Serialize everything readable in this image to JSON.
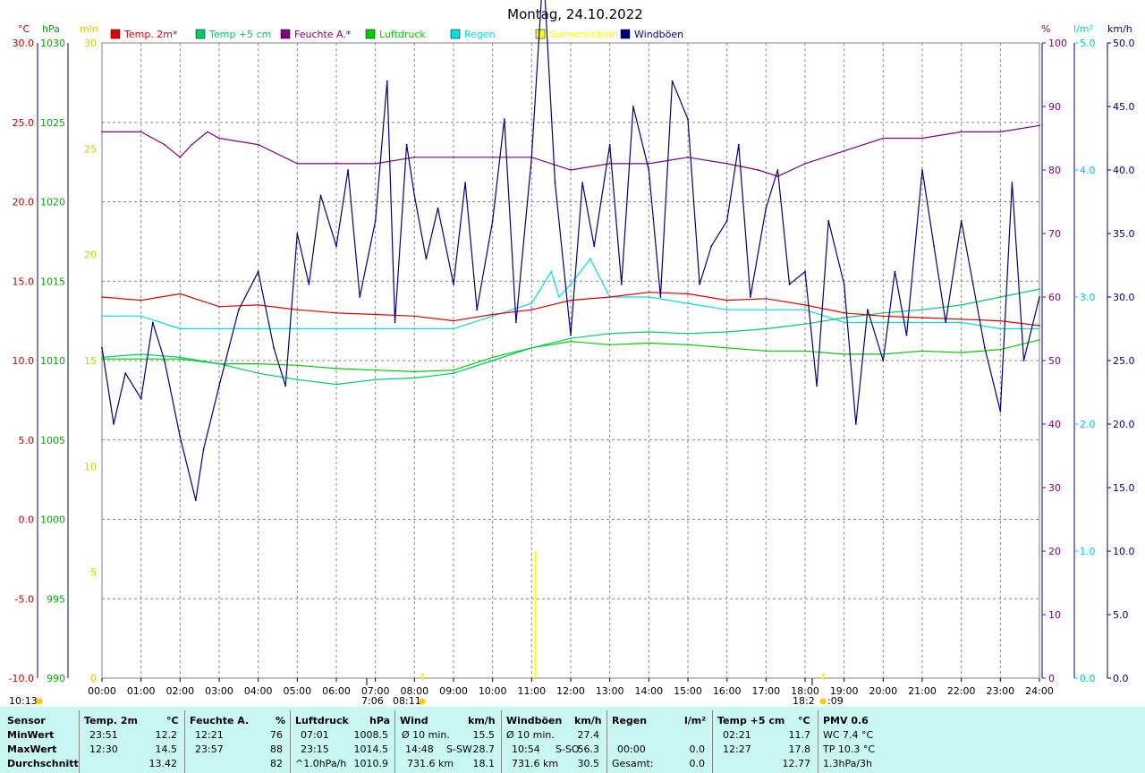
{
  "title": "Montag, 24.10.2022",
  "colors": {
    "temp2m": "#e00000",
    "temp5cm": "#00cc66",
    "humidity": "#800080",
    "pressure": "#00cc00",
    "rain": "#00e0e0",
    "sun": "#ffff00",
    "gust": "#000080",
    "grid": "#888888"
  },
  "axes": {
    "temp": {
      "unit": "°C",
      "ticks": [
        "30.0",
        "25.0",
        "20.0",
        "15.0",
        "10.0",
        "5.0",
        "0.0",
        "-5.0",
        "-10.0"
      ]
    },
    "pressure": {
      "unit": "hPa",
      "ticks": [
        "1030",
        "1025",
        "1020",
        "1015",
        "1010",
        "1005",
        "1000",
        "995",
        "990"
      ]
    },
    "sunmin": {
      "unit": "min",
      "ticks": [
        "30",
        "25",
        "20",
        "15",
        "10",
        "5",
        "0"
      ]
    },
    "humidity": {
      "unit": "%",
      "ticks": [
        "100",
        "90",
        "80",
        "70",
        "60",
        "50",
        "40",
        "30",
        "20",
        "10",
        "0"
      ]
    },
    "rain": {
      "unit": "l/m²",
      "ticks": [
        "5.0",
        "4.0",
        "3.0",
        "2.0",
        "1.0",
        "0.0"
      ]
    },
    "wind": {
      "unit": "km/h",
      "ticks": [
        "50.0",
        "45.0",
        "40.0",
        "35.0",
        "30.0",
        "25.0",
        "20.0",
        "15.0",
        "10.0",
        "5.0",
        "0.0"
      ]
    },
    "x": {
      "ticks": [
        "00:00",
        "01:00",
        "02:00",
        "03:00",
        "04:00",
        "05:00",
        "06:00",
        "07:00",
        "08:00",
        "09:00",
        "10:00",
        "11:00",
        "12:00",
        "13:00",
        "14:00",
        "15:00",
        "16:00",
        "17:00",
        "18:00",
        "19:00",
        "20:00",
        "21:00",
        "22:00",
        "23:00",
        "24:00"
      ]
    }
  },
  "legend": [
    {
      "label": "Temp. 2m*",
      "color": "#e00000"
    },
    {
      "label": "Temp +5 cm",
      "color": "#00cc66"
    },
    {
      "label": "Feuchte A.*",
      "color": "#800080"
    },
    {
      "label": "Luftdruck",
      "color": "#00cc00"
    },
    {
      "label": "Regen",
      "color": "#00e0e0"
    },
    {
      "label": "Sonnenschein",
      "color": "#ffff00"
    },
    {
      "label": "Windböen",
      "color": "#000080"
    }
  ],
  "sun_markers": {
    "sunrise": "7:06",
    "sunrise_event": "08:11",
    "sunset": "18:2",
    "sunset_event": ":09",
    "daylength": "10:13"
  },
  "chart_data": {
    "type": "line",
    "x_unit": "hour",
    "series": [
      {
        "name": "Temp. 2m*",
        "axis": "temp",
        "x": [
          0,
          1,
          2,
          3,
          4,
          5,
          6,
          7,
          8,
          9,
          10,
          11,
          12,
          13,
          14,
          15,
          16,
          17,
          18,
          19,
          20,
          21,
          22,
          23,
          24
        ],
        "values": [
          14.0,
          13.8,
          14.2,
          13.4,
          13.5,
          13.2,
          13.0,
          12.9,
          12.8,
          12.5,
          12.9,
          13.2,
          13.8,
          14.0,
          14.3,
          14.2,
          13.8,
          13.9,
          13.5,
          13.0,
          12.8,
          12.7,
          12.6,
          12.5,
          12.2
        ]
      },
      {
        "name": "Temp +5 cm",
        "axis": "temp",
        "x": [
          0,
          1,
          2,
          3,
          4,
          5,
          6,
          7,
          8,
          9,
          10,
          11,
          12,
          13,
          14,
          15,
          16,
          17,
          18,
          19,
          20,
          21,
          22,
          23,
          24
        ],
        "values": [
          10.2,
          10.4,
          10.2,
          9.8,
          9.2,
          8.8,
          8.5,
          8.8,
          8.9,
          9.2,
          10.0,
          10.8,
          11.4,
          11.7,
          11.8,
          11.7,
          11.8,
          12.0,
          12.3,
          12.7,
          13.0,
          13.2,
          13.5,
          14.0,
          14.5
        ]
      },
      {
        "name": "Feuchte A.*",
        "axis": "humidity",
        "x": [
          0,
          1,
          1.6,
          2,
          2.3,
          2.7,
          3,
          4,
          5,
          6,
          7,
          8,
          9,
          10,
          11,
          12,
          13,
          14,
          15,
          16,
          16.8,
          17.3,
          18,
          19,
          20,
          21,
          22,
          23,
          24
        ],
        "values": [
          86,
          86,
          84,
          82,
          84,
          86,
          85,
          84,
          81,
          81,
          81,
          82,
          82,
          82,
          82,
          80,
          81,
          81,
          82,
          81,
          80,
          79,
          81,
          83,
          85,
          85,
          86,
          86,
          87
        ]
      },
      {
        "name": "Luftdruck",
        "axis": "pressure",
        "x": [
          0,
          1,
          2,
          3,
          4,
          5,
          6,
          7,
          8,
          9,
          10,
          11,
          12,
          13,
          14,
          15,
          16,
          17,
          18,
          19,
          20,
          21,
          22,
          23,
          24
        ],
        "values": [
          1010.1,
          1010.1,
          1010.1,
          1009.8,
          1009.8,
          1009.7,
          1009.5,
          1009.4,
          1009.3,
          1009.4,
          1010.2,
          1010.8,
          1011.2,
          1011.0,
          1011.1,
          1011.0,
          1010.8,
          1010.6,
          1010.6,
          1010.4,
          1010.4,
          1010.6,
          1010.5,
          1010.7,
          1011.3
        ]
      },
      {
        "name": "Regen",
        "axis": "rain",
        "x": [
          0,
          1,
          2,
          3,
          4,
          5,
          6,
          7,
          8,
          9,
          10,
          11,
          11.2,
          11.5,
          11.7,
          12,
          12.5,
          13,
          14,
          15,
          16,
          17,
          18,
          19,
          20,
          21,
          22,
          23,
          24
        ],
        "values": [
          2.85,
          2.85,
          2.75,
          2.75,
          2.75,
          2.75,
          2.75,
          2.75,
          2.75,
          2.75,
          2.85,
          2.95,
          3.05,
          3.2,
          3.0,
          3.1,
          3.3,
          3.0,
          3.0,
          2.95,
          2.9,
          2.9,
          2.9,
          2.8,
          2.8,
          2.8,
          2.8,
          2.75,
          2.75
        ]
      },
      {
        "name": "Windböen",
        "axis": "wind",
        "x": [
          0,
          0.3,
          0.6,
          1,
          1.3,
          1.6,
          2,
          2.4,
          2.6,
          3,
          3.5,
          4,
          4.4,
          4.7,
          5,
          5.3,
          5.6,
          6,
          6.3,
          6.6,
          7,
          7.3,
          7.5,
          7.8,
          8,
          8.3,
          8.6,
          9,
          9.3,
          9.6,
          10,
          10.3,
          10.6,
          11,
          11.3,
          11.6,
          12,
          12.3,
          12.6,
          13,
          13.3,
          13.6,
          14,
          14.3,
          14.6,
          15,
          15.3,
          15.6,
          16,
          16.3,
          16.6,
          17,
          17.3,
          17.6,
          18,
          18.3,
          18.6,
          19,
          19.3,
          19.6,
          20,
          20.3,
          20.6,
          21,
          21.3,
          21.6,
          22,
          22.3,
          22.6,
          23,
          23.3,
          23.6,
          24
        ],
        "values": [
          26,
          20,
          24,
          22,
          28,
          25,
          19,
          14,
          18,
          23,
          29,
          32,
          26,
          23,
          35,
          31,
          38,
          34,
          40,
          30,
          36,
          47,
          28,
          42,
          38,
          33,
          37,
          31,
          39,
          29,
          36,
          44,
          28,
          41,
          56,
          39,
          27,
          39,
          34,
          42,
          31,
          45,
          40,
          30,
          47,
          44,
          31,
          34,
          36,
          42,
          30,
          37,
          40,
          31,
          32,
          23,
          36,
          31,
          20,
          29,
          25,
          32,
          27,
          40,
          34,
          28,
          36,
          31,
          26,
          21,
          39,
          25,
          30
        ]
      }
    ],
    "sunshine_bars": [
      {
        "x": 11.1,
        "minutes": 6
      }
    ]
  },
  "stats": {
    "sensor": {
      "header": "Sensor",
      "rows": [
        "MinWert",
        "MaxWert",
        "Durchschnitt"
      ]
    },
    "temp2m": {
      "header": "Temp. 2m",
      "unit": "°C",
      "rows": [
        [
          "23:51",
          "12.2"
        ],
        [
          "12:30",
          "14.5"
        ],
        [
          "",
          "13.42"
        ]
      ]
    },
    "humidity": {
      "header": "Feuchte A.",
      "unit": "%",
      "rows": [
        [
          "12:21",
          "76"
        ],
        [
          "23:57",
          "88"
        ],
        [
          "",
          "82"
        ]
      ]
    },
    "pressure": {
      "header": "Luftdruck",
      "unit": "hPa",
      "rows": [
        [
          "07:01",
          "1008.5"
        ],
        [
          "23:15",
          "1014.5"
        ],
        [
          "^1.0hPa/h",
          "1010.9"
        ]
      ]
    },
    "wind": {
      "header": "Wind",
      "unit": "km/h",
      "rows": [
        [
          "Ø 10 min.",
          "",
          "15.5"
        ],
        [
          "14:48",
          "S-SW",
          "28.7"
        ],
        [
          "731.6 km",
          "",
          "18.1"
        ]
      ]
    },
    "gust": {
      "header": "Windböen",
      "unit": "km/h",
      "rows": [
        [
          "Ø 10 min.",
          "",
          "27.4"
        ],
        [
          "10:54",
          "S-SO",
          "56.3"
        ],
        [
          "731.6 km",
          "",
          "30.5"
        ]
      ]
    },
    "rain": {
      "header": "Regen",
      "unit": "l/m²",
      "rows": [
        [
          "",
          ""
        ],
        [
          "00:00",
          "0.0"
        ],
        [
          "Gesamt:",
          "0.0"
        ]
      ]
    },
    "temp5cm": {
      "header": "Temp +5 cm",
      "unit": "°C",
      "rows": [
        [
          "02:21",
          "11.7"
        ],
        [
          "12:27",
          "17.8"
        ],
        [
          "",
          "12.77"
        ]
      ]
    },
    "pmv": {
      "header": "PMV 0.6",
      "rows": [
        "WC 7.4 °C",
        "TP 10.3 °C",
        "1.3hPa/3h"
      ]
    }
  }
}
